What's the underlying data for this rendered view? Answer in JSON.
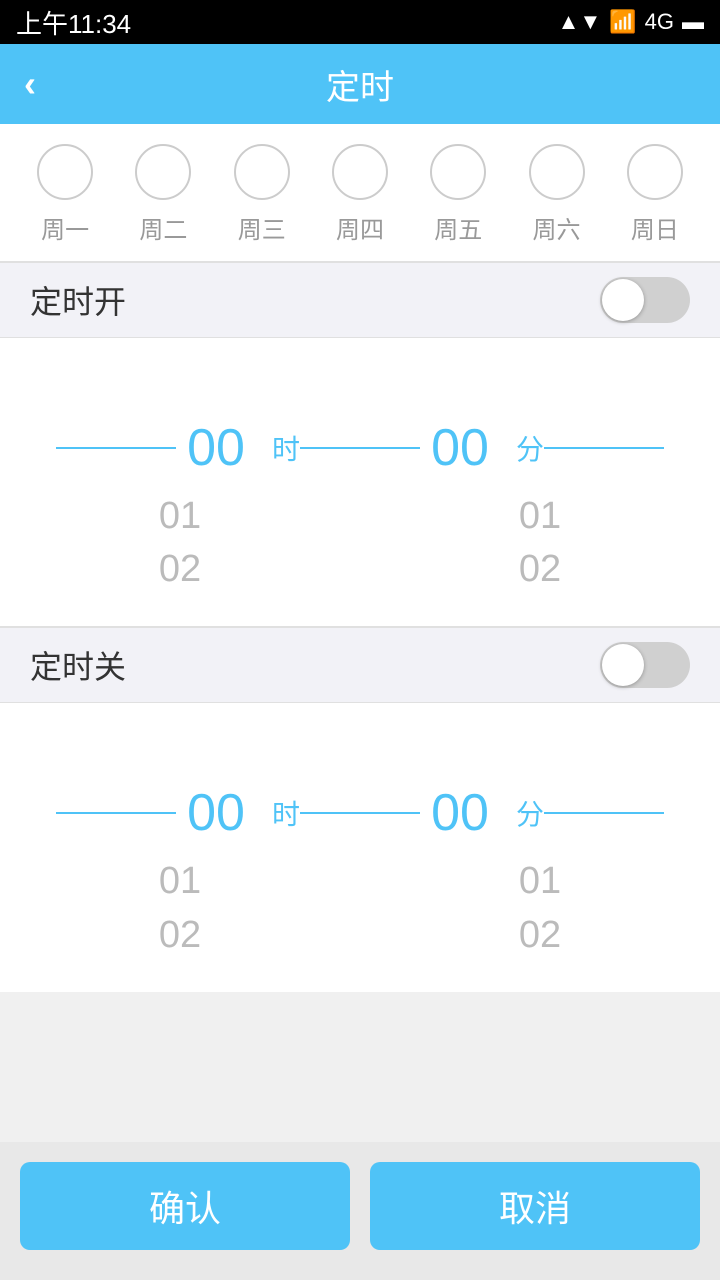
{
  "statusBar": {
    "time": "上午11:34",
    "signal": "▲▼",
    "network": "4G",
    "battery": "🔋"
  },
  "header": {
    "back": "‹",
    "title": "定时"
  },
  "days": {
    "circles": [
      "",
      "",
      "",
      "",
      "",
      "",
      ""
    ],
    "labels": [
      "周一",
      "周二",
      "周三",
      "周四",
      "周五",
      "周六",
      "周日"
    ]
  },
  "timerOn": {
    "label": "定时开",
    "toggle": false
  },
  "timerOnPicker": {
    "hour": "00",
    "hourLabel": "时",
    "minute": "00",
    "minuteLabel": "分",
    "hourSub1": "01",
    "hourSub2": "02",
    "minuteSub1": "01",
    "minuteSub2": "02"
  },
  "timerOff": {
    "label": "定时关",
    "toggle": false
  },
  "timerOffPicker": {
    "hour": "00",
    "hourLabel": "时",
    "minute": "00",
    "minuteLabel": "分",
    "hourSub1": "01",
    "hourSub2": "02",
    "minuteSub1": "01",
    "minuteSub2": "02"
  },
  "buttons": {
    "confirm": "确认",
    "cancel": "取消"
  }
}
